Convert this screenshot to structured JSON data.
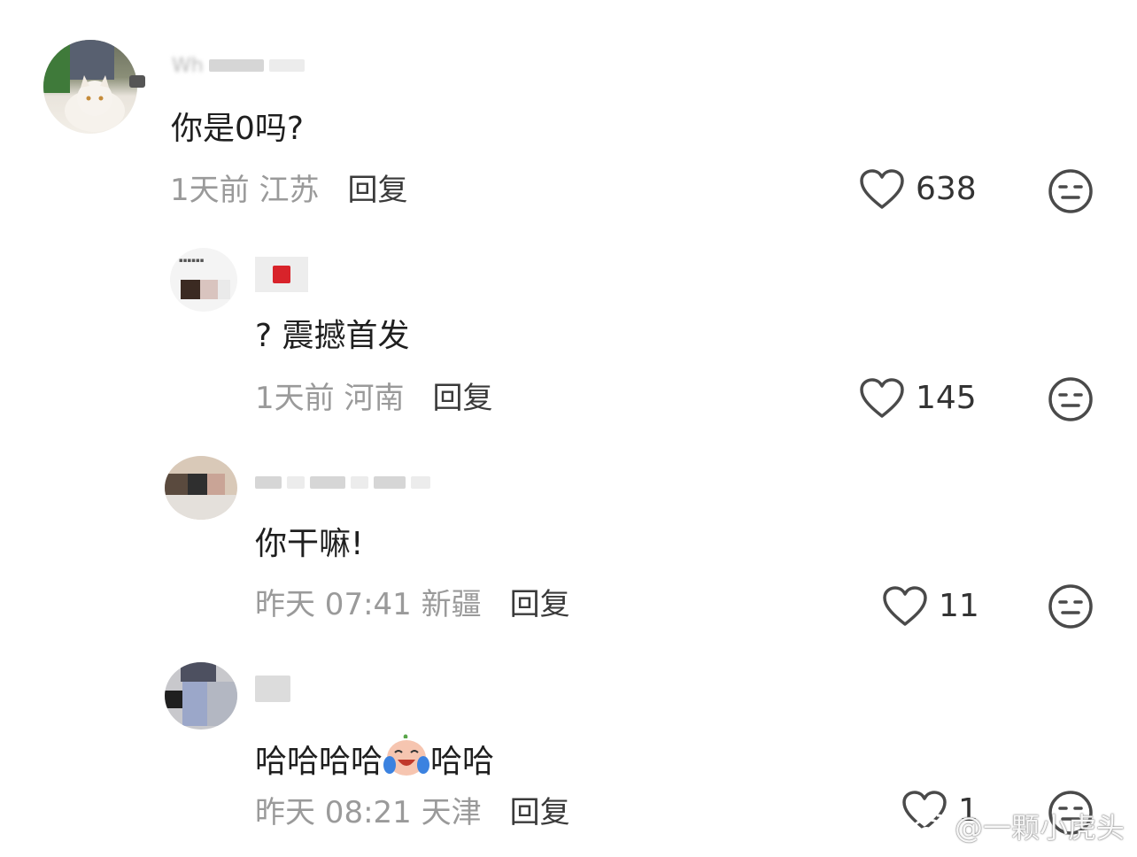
{
  "comments": [
    {
      "avatar": "cat-photo-avatar",
      "username": "Wh",
      "text": "你是0吗?",
      "meta": "1天前 江苏",
      "reply_label": "回复",
      "likes": "638"
    },
    {
      "avatar": "blurred-avatar",
      "username": "",
      "text": "? 震撼首发",
      "meta": "1天前 河南",
      "reply_label": "回复",
      "likes": "145"
    },
    {
      "avatar": "blurred-avatar",
      "username": "",
      "text": "你干嘛!",
      "meta": "昨天 07:41 新疆",
      "reply_label": "回复",
      "likes": "11"
    },
    {
      "avatar": "blurred-avatar",
      "username": "",
      "text_before": "哈哈哈哈",
      "emoji": "crying-laughing-emoji",
      "text_after": "哈哈",
      "meta": "昨天 08:21 天津",
      "reply_label": "回复",
      "likes": "1"
    }
  ],
  "icons": {
    "like": "heart-outline-icon",
    "dislike": "neutral-face-icon"
  },
  "watermark": "@一颗小虎头"
}
